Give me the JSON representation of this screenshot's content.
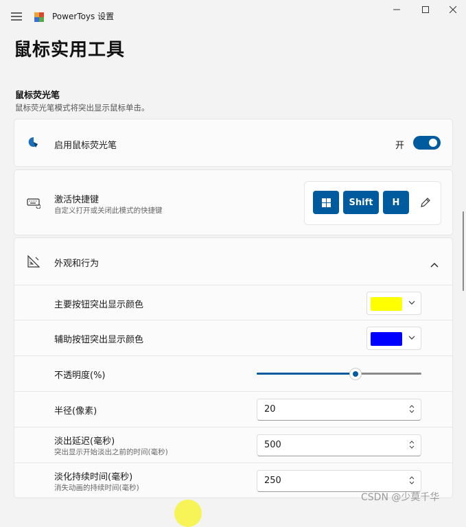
{
  "app_title": "PowerToys 设置",
  "page_title": "鼠标实用工具",
  "section": {
    "title": "鼠标荧光笔",
    "subtitle": "鼠标荧光笔模式将突出显示鼠标单击。"
  },
  "enable_card": {
    "label": "启用鼠标荧光笔",
    "toggle_state": "开",
    "toggle_on": true
  },
  "shortcut_card": {
    "title": "激活快捷键",
    "subtitle": "自定义打开或关闭此模式的快捷键",
    "keys": [
      "Shift",
      "H"
    ],
    "win_key_icon": "windows-logo-icon"
  },
  "appearance": {
    "title": "外观和行为",
    "expanded": true,
    "rows": {
      "primary_color_label": "主要按钮突出显示颜色",
      "primary_color": "#ffff00",
      "secondary_color_label": "辅助按钮突出显示颜色",
      "secondary_color": "#0000ff",
      "opacity_label": "不透明度(%)",
      "opacity_value": 0.6,
      "radius_label": "半径(像素)",
      "radius_value": "20",
      "fade_delay_label": "淡出延迟(毫秒)",
      "fade_delay_sub": "突出显示开始淡出之前的时间(毫秒)",
      "fade_delay_value": "500",
      "fade_duration_label": "淡化持续时间(毫秒)",
      "fade_duration_sub": "消失动画的持续时间(毫秒)",
      "fade_duration_value": "250"
    }
  },
  "accent_color": "#005a9e",
  "watermark": "CSDN @少莫千华"
}
